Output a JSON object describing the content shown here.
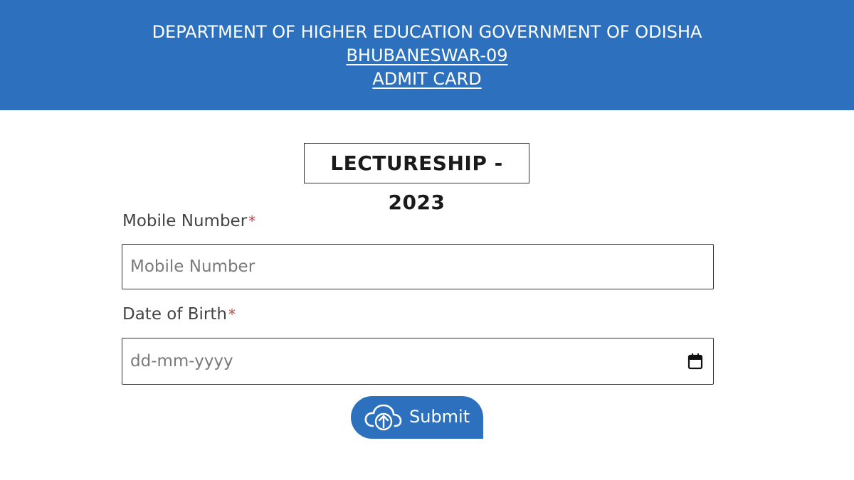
{
  "header": {
    "line1": "DEPARTMENT OF HIGHER EDUCATION GOVERNMENT OF ODISHA",
    "line2": "BHUBANESWAR-09",
    "line3": "ADMIT CARD",
    "background": "#2d71be"
  },
  "exam_title": "LECTURESHIP - 2023",
  "form": {
    "mobile": {
      "label": "Mobile Number",
      "required_mark": "*",
      "placeholder": "Mobile Number",
      "value": ""
    },
    "dob": {
      "label": "Date of Birth",
      "required_mark": "*",
      "placeholder": "dd-mm-yyyy",
      "value": "",
      "icon": "calendar-icon"
    },
    "submit": {
      "label": "Submit",
      "icon": "cloud-upload-icon"
    }
  }
}
